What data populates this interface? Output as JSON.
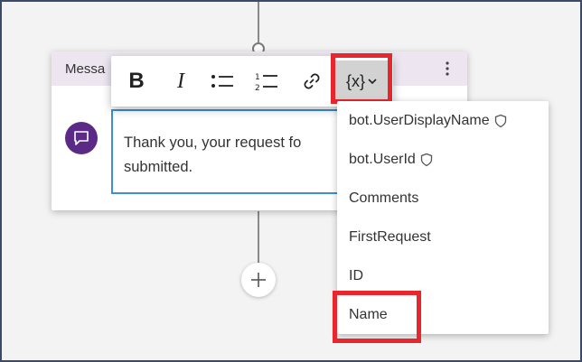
{
  "card": {
    "title": "Messa",
    "message_text": "Thank you, your request fo\nsubmitted."
  },
  "toolbar": {
    "bold_label": "B",
    "italic_label": "I",
    "variable_label": "{x}"
  },
  "variables_menu": {
    "items": [
      {
        "label": "bot.UserDisplayName",
        "icon": "shield-icon"
      },
      {
        "label": "bot.UserId",
        "icon": "shield-icon"
      },
      {
        "label": "Comments"
      },
      {
        "label": "FirstRequest"
      },
      {
        "label": "ID"
      },
      {
        "label": "Name"
      }
    ]
  },
  "colors": {
    "highlight": "#e8262e",
    "accent": "#5b2a86",
    "focus_border": "#3c8fd8",
    "header_bg": "#ede6f1"
  }
}
